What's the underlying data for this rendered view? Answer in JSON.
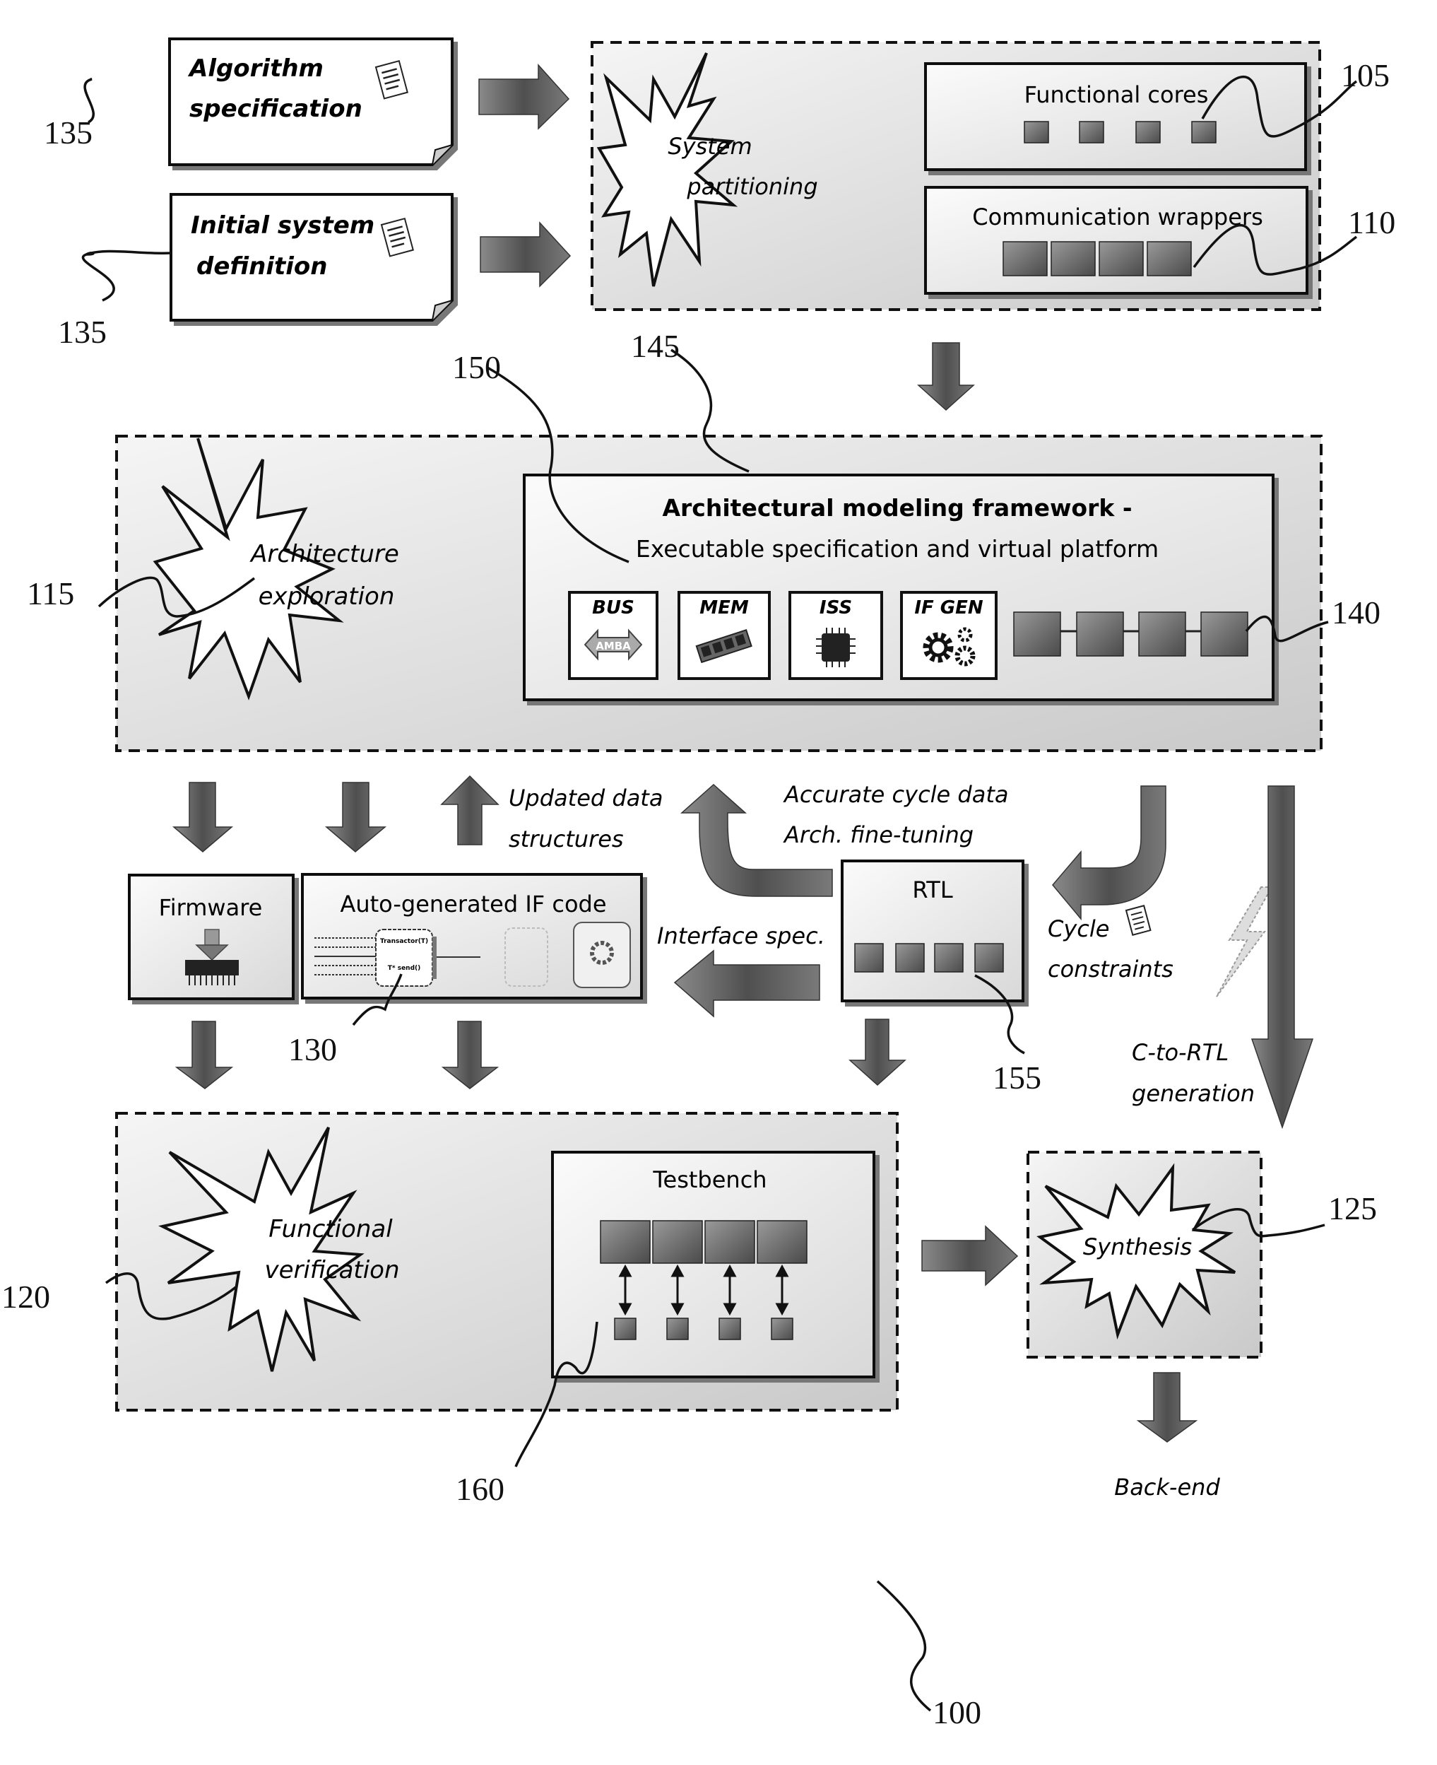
{
  "figure": {
    "reference_numeral": "100",
    "inputs": [
      {
        "ref": "135",
        "line1": "Algorithm",
        "line2": "specification",
        "icon": "document-icon"
      },
      {
        "ref": "135",
        "line1": "Initial system",
        "line2": "definition",
        "icon": "document-icon"
      }
    ],
    "system_partitioning": {
      "ref": "145",
      "burst_line1": "System",
      "burst_line2": "partitioning",
      "functional_cores": {
        "ref": "105",
        "label": "Functional cores",
        "count": 4
      },
      "communication_wrappers": {
        "ref": "110",
        "label": "Communication wrappers",
        "count": 4
      }
    },
    "architecture": {
      "ref": "115",
      "burst_line1": "Architecture",
      "burst_line2": "exploration",
      "framework": {
        "ref": "150",
        "title": "Architectural modeling framework -",
        "subtitle": "Executable specification and virtual platform",
        "blocks": [
          {
            "label": "BUS",
            "icon": "amba-bus-icon",
            "icon_text": "AMBA"
          },
          {
            "label": "MEM",
            "icon": "memory-module-icon"
          },
          {
            "label": "ISS",
            "icon": "processor-chip-icon"
          },
          {
            "label": "IF GEN",
            "icon": "gears-icon"
          }
        ],
        "chain_ref": "140",
        "chain_count": 4
      }
    },
    "middle": {
      "firmware": {
        "label": "Firmware",
        "icon": "download-to-chip-icon"
      },
      "if_code": {
        "ref": "130",
        "label": "Auto-generated IF code",
        "transactor_text": "Transactor(T)",
        "method_text": "T* send()"
      },
      "rtl": {
        "ref": "155",
        "label": "RTL",
        "count": 4
      },
      "updated_line1": "Updated data",
      "updated_line2": "structures",
      "accurate_line1": "Accurate cycle data",
      "accurate_line2": "Arch. fine-tuning",
      "interface_spec": "Interface spec.",
      "cycle_line1": "Cycle",
      "cycle_line2": "constraints",
      "c2rtl_line1": "C-to-RTL",
      "c2rtl_line2": "generation"
    },
    "verification": {
      "ref": "120",
      "burst_line1": "Functional",
      "burst_line2": "verification",
      "testbench": {
        "ref": "160",
        "label": "Testbench",
        "count": 4
      }
    },
    "synthesis": {
      "ref": "125",
      "label": "Synthesis"
    },
    "backend_label": "Back-end"
  }
}
